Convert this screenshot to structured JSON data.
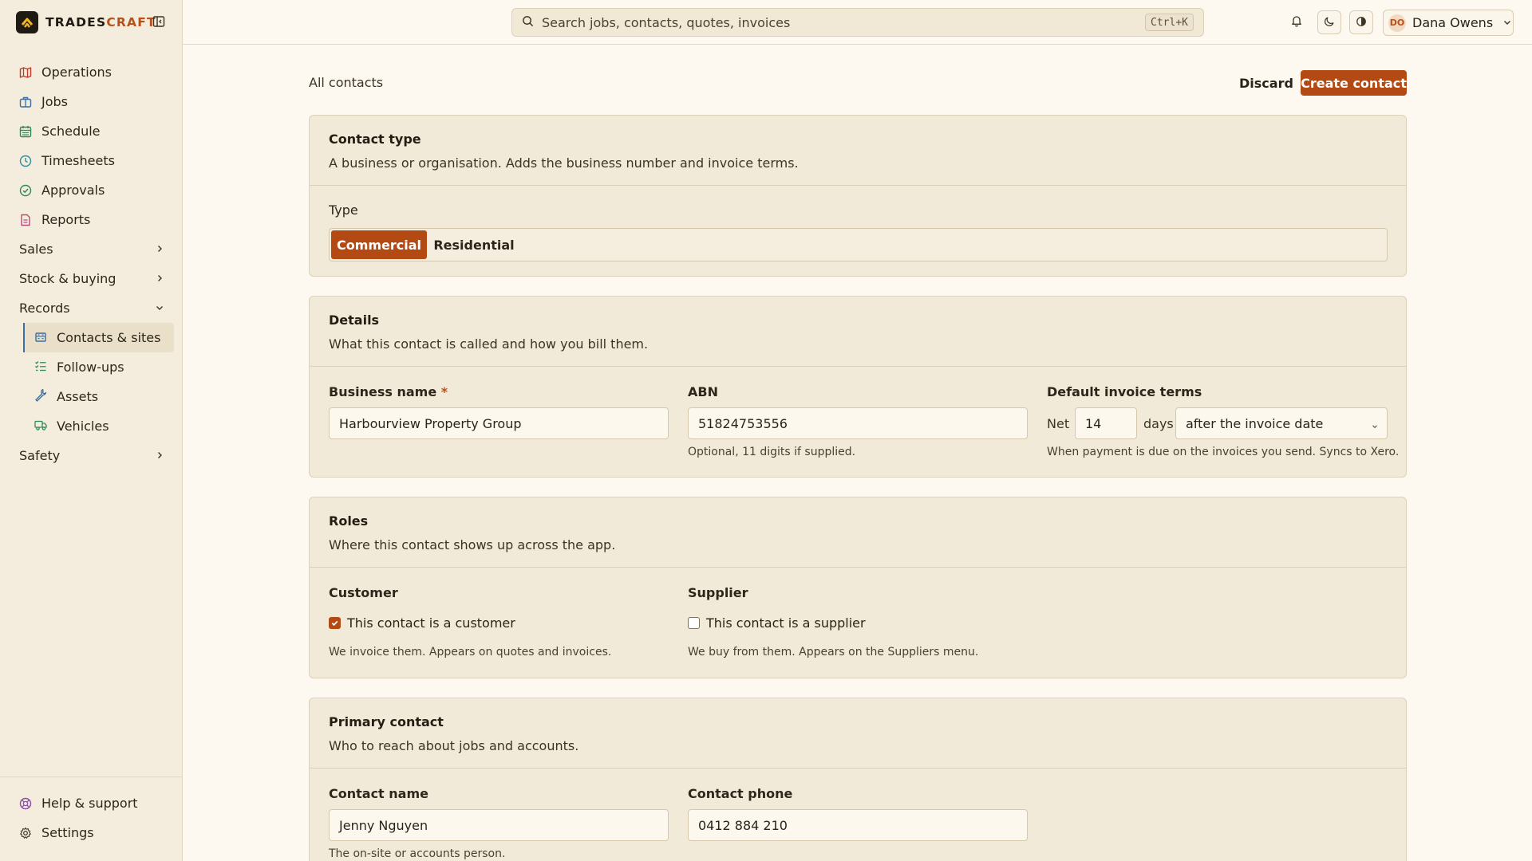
{
  "brand": {
    "name_main": "TRADES",
    "name_accent": "CRAFT"
  },
  "sidebar": {
    "items": [
      {
        "label": "Operations",
        "icon": "map-icon",
        "color": "#c0392b"
      },
      {
        "label": "Jobs",
        "icon": "briefcase-icon",
        "color": "#3a6fa0"
      },
      {
        "label": "Schedule",
        "icon": "calendar-icon",
        "color": "#2e8b57"
      },
      {
        "label": "Timesheets",
        "icon": "clock-icon",
        "color": "#2f8f9d"
      },
      {
        "label": "Approvals",
        "icon": "check-circle-icon",
        "color": "#2e8b57"
      },
      {
        "label": "Reports",
        "icon": "report-icon",
        "color": "#b84a7a"
      }
    ],
    "groups": {
      "sales": "Sales",
      "stock": "Stock & buying",
      "records": "Records",
      "safety": "Safety"
    },
    "records_items": [
      {
        "label": "Contacts & sites",
        "icon": "building-icon"
      },
      {
        "label": "Follow-ups",
        "icon": "list-check-icon"
      },
      {
        "label": "Assets",
        "icon": "wrench-icon"
      },
      {
        "label": "Vehicles",
        "icon": "truck-icon"
      }
    ],
    "bottom": {
      "help": "Help & support",
      "settings": "Settings"
    }
  },
  "topbar": {
    "search_placeholder": "Search jobs, contacts, quotes, invoices",
    "shortcut": "Ctrl+K",
    "user_initials": "DO",
    "user_name": "Dana Owens"
  },
  "page": {
    "breadcrumb": "All contacts",
    "discard": "Discard",
    "create": "Create contact"
  },
  "contact_type": {
    "title": "Contact type",
    "subtitle": "A business or organisation. Adds the business number and invoice terms.",
    "type_label": "Type",
    "options": [
      "Commercial",
      "Residential"
    ],
    "selected": "Commercial"
  },
  "details": {
    "title": "Details",
    "subtitle": "What this contact is called and how you bill them.",
    "business_name_label": "Business name",
    "required_mark": "*",
    "business_name": "Harbourview Property Group",
    "abn_label": "ABN",
    "abn": "51824753556",
    "abn_hint": "Optional, 11 digits if supplied.",
    "terms_label": "Default invoice terms",
    "net": "Net",
    "net_days": "14",
    "days": "days",
    "terms_option": "after the invoice date",
    "terms_hint": "When payment is due on the invoices you send. Syncs to Xero."
  },
  "roles": {
    "title": "Roles",
    "subtitle": "Where this contact shows up across the app.",
    "customer_label": "Customer",
    "customer_check": "This contact is a customer",
    "customer_checked": true,
    "customer_hint": "We invoice them. Appears on quotes and invoices.",
    "supplier_label": "Supplier",
    "supplier_check": "This contact is a supplier",
    "supplier_checked": false,
    "supplier_hint": "We buy from them. Appears on the Suppliers menu."
  },
  "primary_contact": {
    "title": "Primary contact",
    "subtitle": "Who to reach about jobs and accounts.",
    "name_label": "Contact name",
    "name": "Jenny Nguyen",
    "name_hint": "The on-site or accounts person.",
    "phone_label": "Contact phone",
    "phone": "0412 884 210"
  },
  "colors": {
    "accent": "#b34a14",
    "background": "#fdf9f1",
    "sidebar": "#f4ecdc",
    "card": "#f2ead9"
  }
}
